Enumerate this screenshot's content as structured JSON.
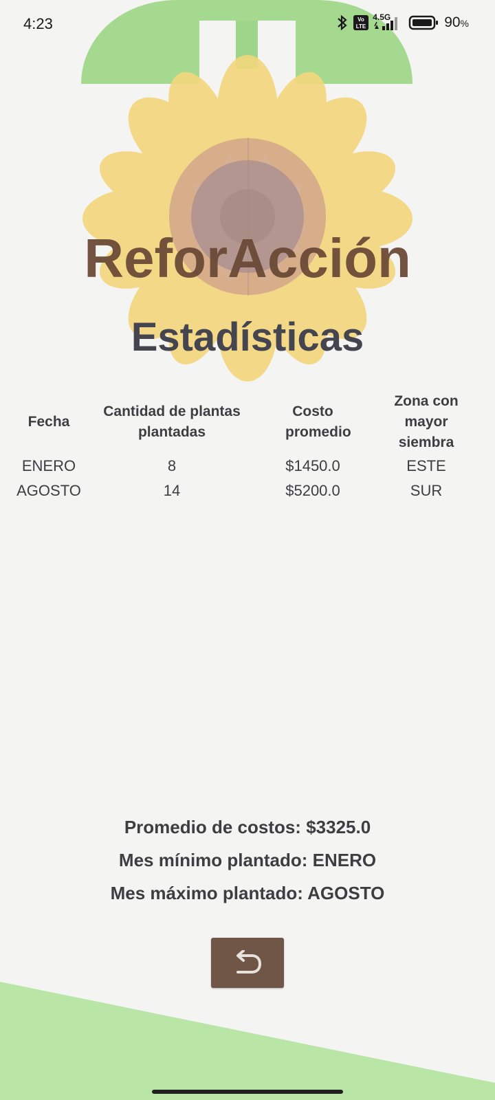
{
  "status_bar": {
    "time": "4:23",
    "network": "4.5G",
    "volte": "Vo LTE",
    "battery_percent": "90",
    "battery_unit": "%",
    "battery_level": 0.9
  },
  "app": {
    "title": "ReforAcción",
    "section_title": "Estadísticas"
  },
  "table": {
    "headers": {
      "date": "Fecha",
      "plants": "Cantidad de plantas plantadas",
      "cost": "Costo promedio",
      "zone": "Zona con mayor siembra"
    },
    "rows": [
      {
        "date": "ENERO",
        "plants": "8",
        "cost": "$1450.0",
        "zone": "ESTE"
      },
      {
        "date": "AGOSTO",
        "plants": "14",
        "cost": "$5200.0",
        "zone": "SUR"
      }
    ]
  },
  "summary": {
    "average_cost": "Promedio de costos: $3325.0",
    "min_month": "Mes mínimo plantado: ENERO",
    "max_month": "Mes máximo plantado: AGOSTO"
  },
  "back_button": {
    "icon": "undo-arrow-icon"
  },
  "colors": {
    "background": "#f4f4f3",
    "title_brown": "#6a4a36",
    "button_brown": "#6f5646",
    "leaf_green": "#a5d98f",
    "petal_yellow": "#f3d77c",
    "ground_green": "#b9e6a6"
  }
}
